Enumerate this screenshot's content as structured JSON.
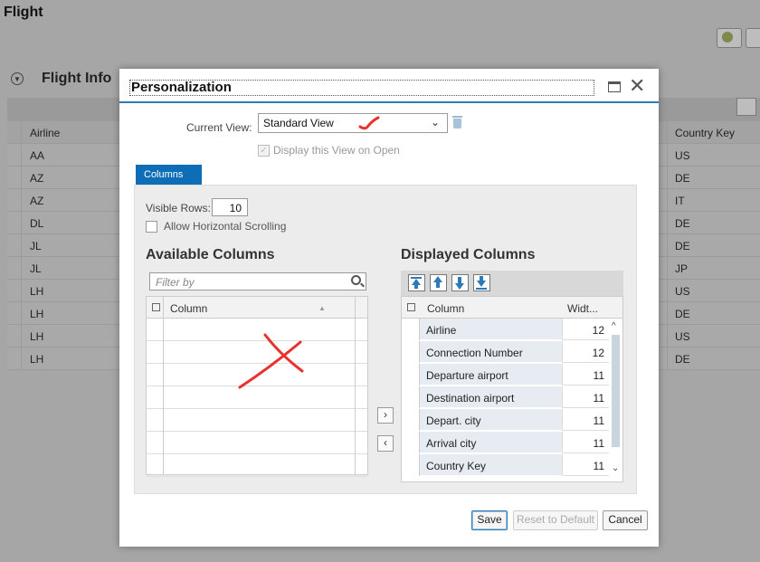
{
  "page": {
    "title": "Flight",
    "section_title": "Flight Info",
    "table": {
      "col_airline": "Airline",
      "col_country": "Country Key",
      "rows": [
        {
          "airline": "AA",
          "country": "US"
        },
        {
          "airline": "AZ",
          "country": "DE"
        },
        {
          "airline": "AZ",
          "country": "IT"
        },
        {
          "airline": "DL",
          "country": "DE"
        },
        {
          "airline": "JL",
          "country": "DE"
        },
        {
          "airline": "JL",
          "country": "JP"
        },
        {
          "airline": "LH",
          "country": "US"
        },
        {
          "airline": "LH",
          "country": "DE"
        },
        {
          "airline": "LH",
          "country": "US"
        },
        {
          "airline": "LH",
          "country": "DE"
        }
      ]
    }
  },
  "dialog": {
    "title": "Personalization",
    "current_view_label": "Current View:",
    "current_view_value": "Standard View",
    "display_on_open_label": "Display this View on Open",
    "tab_label": "Columns",
    "visible_rows_label": "Visible Rows:",
    "visible_rows_value": "10",
    "allow_scroll_label": "Allow Horizontal Scrolling",
    "available_heading": "Available Columns",
    "displayed_heading": "Displayed Columns",
    "filter_placeholder": "Filter by",
    "available_col_header": "Column",
    "displayed_col_header": "Column",
    "displayed_width_header": "Widt...",
    "add_label": "›",
    "remove_label": "‹",
    "displayed_rows": [
      {
        "name": "Airline",
        "width": "12"
      },
      {
        "name": "Connection Number",
        "width": "12"
      },
      {
        "name": "Departure airport",
        "width": "11"
      },
      {
        "name": "Destination airport",
        "width": "11"
      },
      {
        "name": "Depart. city",
        "width": "11"
      },
      {
        "name": "Arrival city",
        "width": "11"
      },
      {
        "name": "Country Key",
        "width": "11"
      }
    ],
    "buttons": {
      "save": "Save",
      "reset": "Reset to Default",
      "cancel": "Cancel"
    }
  },
  "colors": {
    "accent": "#2f79b7",
    "tab": "#0d6eb7",
    "annotation": "#e8322d"
  }
}
